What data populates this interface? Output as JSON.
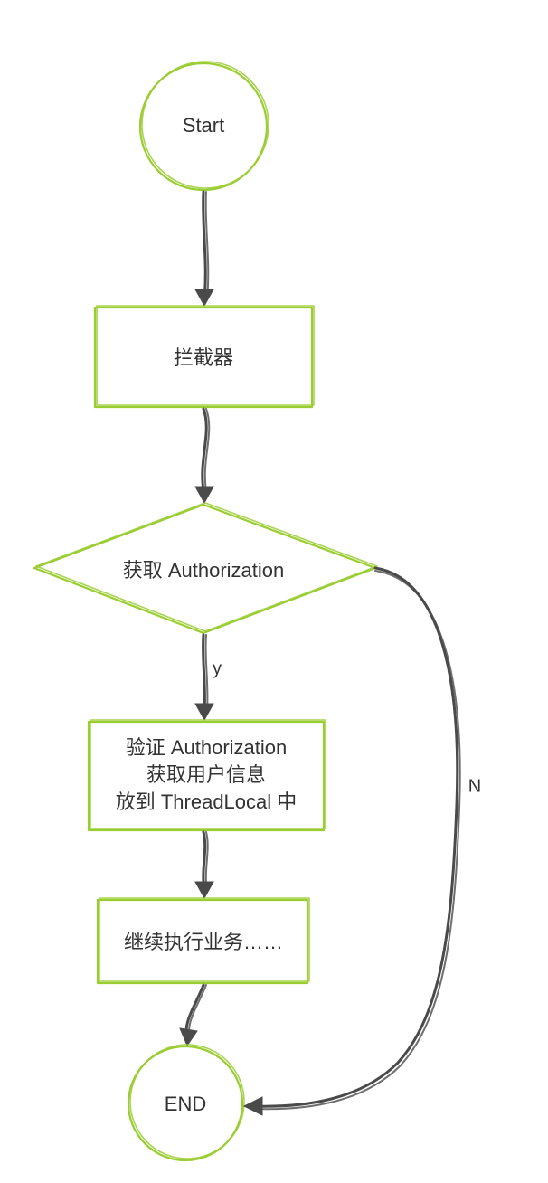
{
  "nodes": {
    "start": "Start",
    "interceptor": "拦截器",
    "decision": "获取 Authorization",
    "verify_line1": "验证 Authorization",
    "verify_line2": "获取用户信息",
    "verify_line3": "放到 ThreadLocal 中",
    "continue": "继续执行业务……",
    "end": "END"
  },
  "edges": {
    "yes": "y",
    "no": "N"
  },
  "colors": {
    "shape_stroke": "#9acd32",
    "arrow": "#4a4a4a",
    "background": "#ffffff"
  },
  "chart_data": {
    "type": "flowchart",
    "title": "",
    "nodes": [
      {
        "id": "start",
        "shape": "terminator-circle",
        "label": "Start"
      },
      {
        "id": "interceptor",
        "shape": "process",
        "label": "拦截器"
      },
      {
        "id": "decision",
        "shape": "decision",
        "label": "获取 Authorization"
      },
      {
        "id": "verify",
        "shape": "process",
        "label": "验证 Authorization 获取用户信息 放到 ThreadLocal 中"
      },
      {
        "id": "continue",
        "shape": "process",
        "label": "继续执行业务……"
      },
      {
        "id": "end",
        "shape": "terminator-circle",
        "label": "END"
      }
    ],
    "edges": [
      {
        "from": "start",
        "to": "interceptor",
        "label": ""
      },
      {
        "from": "interceptor",
        "to": "decision",
        "label": ""
      },
      {
        "from": "decision",
        "to": "verify",
        "label": "y"
      },
      {
        "from": "decision",
        "to": "end",
        "label": "N"
      },
      {
        "from": "verify",
        "to": "continue",
        "label": ""
      },
      {
        "from": "continue",
        "to": "end",
        "label": ""
      }
    ]
  }
}
